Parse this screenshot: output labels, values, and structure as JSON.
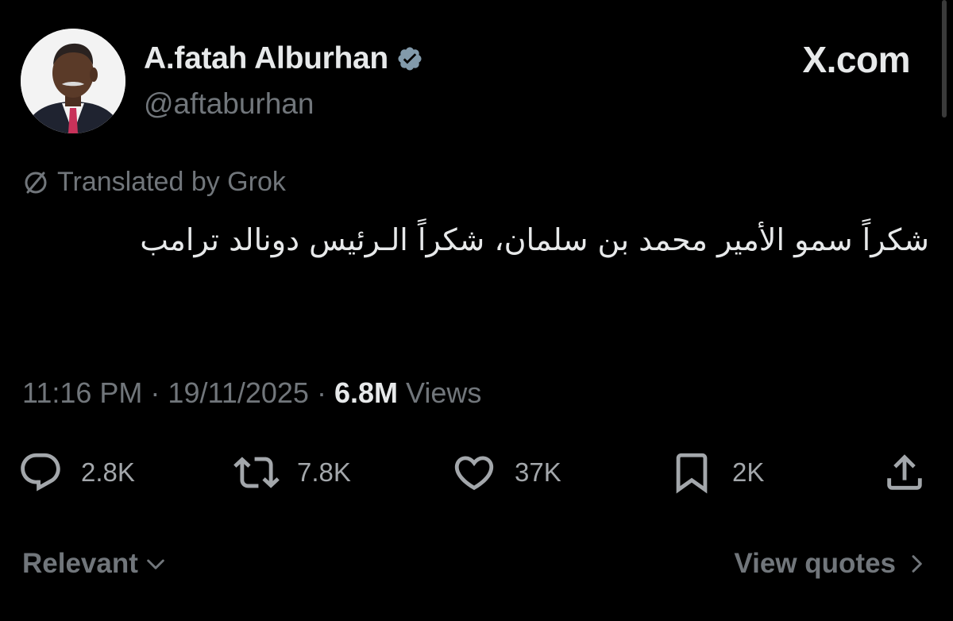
{
  "author": {
    "name": "A.fatah Alburhan",
    "handle": "@aftaburhan",
    "verified": true
  },
  "site": {
    "label": "X.com"
  },
  "translation": {
    "label": "Translated by Grok"
  },
  "tweet": {
    "text": "شكراً سمو الأمير محمد بن سلمان، شكراً الـرئيس دونالد ترامب"
  },
  "meta": {
    "time": "11:16 PM",
    "separator": "·",
    "date": "19/11/2025",
    "views_count": "6.8M",
    "views_label": "Views"
  },
  "actions": {
    "replies": "2.8K",
    "reposts": "7.8K",
    "likes": "37K",
    "bookmarks": "2K"
  },
  "footer": {
    "sort_label": "Relevant",
    "quotes_label": "View quotes"
  },
  "icons": {
    "verified": "verified-badge-icon",
    "translate": "translate-slash-icon",
    "reply": "reply-icon",
    "repost": "repost-icon",
    "like": "heart-icon",
    "bookmark": "bookmark-icon",
    "share": "share-icon"
  },
  "colors": {
    "background": "#000000",
    "primary_text": "#e7e9ea",
    "secondary_text": "#71767b",
    "action_text": "#a3a7ab"
  }
}
